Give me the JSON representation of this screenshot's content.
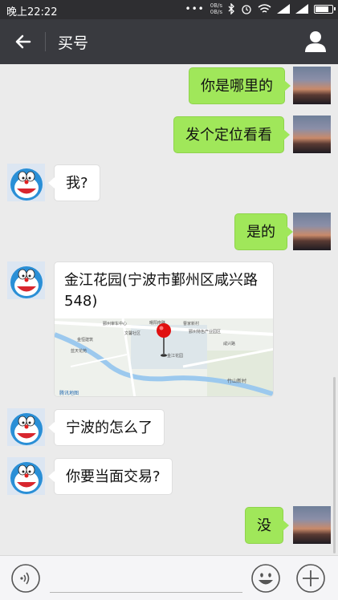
{
  "status_bar": {
    "time": "晚上22:22",
    "net_speed_up": "0B/s",
    "net_speed_down": "0B/s",
    "battery_level": 0.85
  },
  "header": {
    "title": "买号"
  },
  "messages": [
    {
      "side": "right",
      "text": "你是哪里的"
    },
    {
      "side": "right",
      "text": "发个定位看看"
    },
    {
      "side": "left",
      "text": "我?"
    },
    {
      "side": "right",
      "text": "是的"
    },
    {
      "side": "left",
      "type": "location",
      "text": "金江花园(宁波市鄞州区咸兴路548)"
    },
    {
      "side": "left",
      "text": "宁波的怎么了"
    },
    {
      "side": "left",
      "text": "你要当面交易?"
    },
    {
      "side": "right",
      "text": "没"
    }
  ],
  "map": {
    "labels": [
      "曙阳南路",
      "鄞州审车中心",
      "金恒建筑",
      "蓝天花苑",
      "文馨社区",
      "曹家新村",
      "鄞州特色产业园区",
      "金江花园",
      "腾讯地图",
      "竹山新村",
      "咸兴路"
    ]
  },
  "input": {
    "placeholder": ""
  },
  "colors": {
    "header_bg": "#393a3f",
    "chat_bg": "#ebebeb",
    "own_bubble": "#a0e75a",
    "other_bubble": "#ffffff"
  }
}
